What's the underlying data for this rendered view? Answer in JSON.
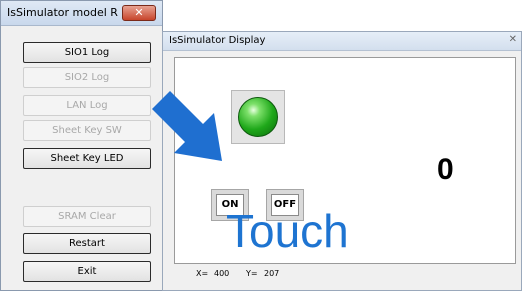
{
  "control_window": {
    "title": "IsSimulator model R",
    "close_symbol": "✕",
    "buttons": [
      {
        "label": "SIO1 Log"
      },
      {
        "label": "SIO2 Log"
      },
      {
        "label": "LAN Log"
      },
      {
        "label": "Sheet Key SW"
      },
      {
        "label": "Sheet Key LED"
      },
      {
        "label": "SRAM Clear"
      },
      {
        "label": "Restart"
      },
      {
        "label": "Exit"
      }
    ]
  },
  "display_window": {
    "title": "IsSimulator Display",
    "close_symbol": "✕",
    "on_label": "ON",
    "off_label": "OFF",
    "counter": "0",
    "x_label": "X=",
    "x_value": "400",
    "y_label": "Y=",
    "y_value": "207"
  },
  "overlay": {
    "touch_text": "Touch",
    "arrow_color": "#1f6fd0"
  }
}
